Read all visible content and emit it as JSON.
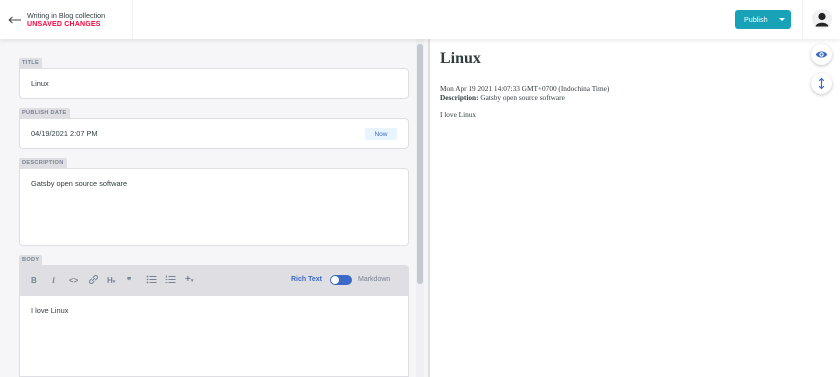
{
  "header": {
    "collection_label": "Writing in Blog collection",
    "status": "UNSAVED CHANGES",
    "publish_label": "Publish",
    "back_icon": "arrow-left-icon",
    "avatar_icon": "user-icon"
  },
  "fields": {
    "title": {
      "label": "TITLE",
      "value": "Linux"
    },
    "publish_date": {
      "label": "PUBLISH DATE",
      "value": "04/19/2021 2:07 PM",
      "now_label": "Now"
    },
    "description": {
      "label": "DESCRIPTION",
      "value": "Gatsby open source software"
    },
    "body": {
      "label": "BODY",
      "value": "I love Linux",
      "toolbar": {
        "bold": "B",
        "italic": "I",
        "code": "<>",
        "link": "link-icon",
        "heading": "H",
        "quote": "❞",
        "bulleted_list": "bulleted-list-icon",
        "numbered_list": "numbered-list-icon",
        "add": "+"
      },
      "mode_rich_text": "Rich Text",
      "mode_markdown": "Markdown"
    }
  },
  "preview": {
    "title": "Linux",
    "date": "Mon Apr 19 2021 14:07:33 GMT+0700 (Indochina Time)",
    "description_label": "Description:",
    "description": "Gatsby open source software",
    "body": "I love Linux"
  },
  "colors": {
    "accent": "#17a2b8",
    "unsaved": "#ff003b",
    "rich_text_blue": "#3a69c7"
  }
}
